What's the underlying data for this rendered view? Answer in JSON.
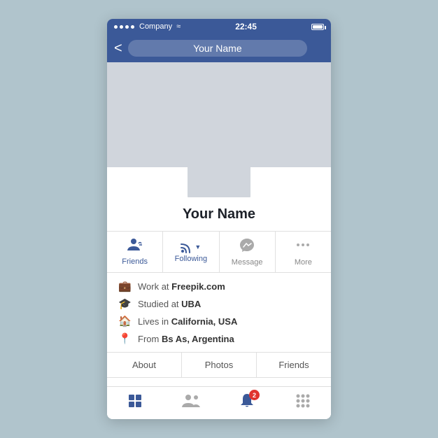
{
  "statusBar": {
    "carrier": "Company",
    "time": "22:45",
    "signal_dots": 4
  },
  "navBar": {
    "back_label": "<",
    "title": "Your Name"
  },
  "profile": {
    "name": "Your Name"
  },
  "actionButtons": [
    {
      "id": "friends",
      "label": "Friends",
      "icon": "friends"
    },
    {
      "id": "following",
      "label": "Following",
      "icon": "rss",
      "hasDropdown": true
    },
    {
      "id": "message",
      "label": "Message",
      "icon": "messenger",
      "gray": true
    },
    {
      "id": "more",
      "label": "More",
      "icon": "dots",
      "gray": true
    }
  ],
  "infoItems": [
    {
      "icon": "briefcase",
      "text": "Work at ",
      "highlight": "Freepik.com"
    },
    {
      "icon": "graduation",
      "text": "Studied at ",
      "highlight": "UBA"
    },
    {
      "icon": "home",
      "text": "Lives in ",
      "highlight": "California, USA"
    },
    {
      "icon": "pin",
      "text": "From ",
      "highlight": "Bs As, Argentina"
    }
  ],
  "tabs": [
    "About",
    "Photos",
    "Friends"
  ],
  "bottomNav": [
    {
      "id": "home",
      "icon": "home-nav",
      "badge": null
    },
    {
      "id": "friends-nav",
      "icon": "friends-nav",
      "badge": null
    },
    {
      "id": "notifications",
      "icon": "bell",
      "badge": "2"
    },
    {
      "id": "menu",
      "icon": "grid",
      "badge": null
    }
  ]
}
